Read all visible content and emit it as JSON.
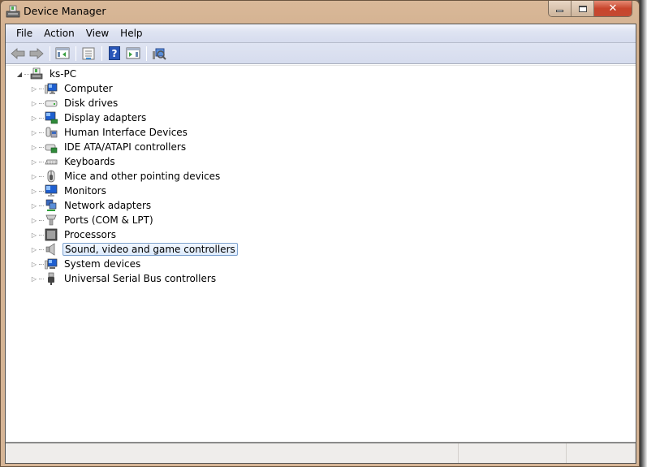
{
  "window": {
    "title": "Device Manager",
    "controls": {
      "minimize": "minimize",
      "maximize": "maximize",
      "close": "close"
    }
  },
  "menubar": {
    "items": [
      {
        "label": "File"
      },
      {
        "label": "Action"
      },
      {
        "label": "View"
      },
      {
        "label": "Help"
      }
    ]
  },
  "toolbar": {
    "buttons": [
      {
        "name": "back",
        "icon": "arrow-left-icon"
      },
      {
        "name": "forward",
        "icon": "arrow-right-icon"
      },
      {
        "name": "show-hide-console-tree",
        "icon": "console-tree-icon"
      },
      {
        "name": "properties",
        "icon": "properties-icon"
      },
      {
        "name": "help",
        "icon": "help-icon"
      },
      {
        "name": "show-action-pane",
        "icon": "action-pane-icon"
      },
      {
        "name": "scan-for-hardware-changes",
        "icon": "scan-hardware-icon"
      }
    ]
  },
  "tree": {
    "root": {
      "label": "ks-PC",
      "expanded": true,
      "icon": "computer-root-icon"
    },
    "children": [
      {
        "label": "Computer",
        "icon": "computer-icon"
      },
      {
        "label": "Disk drives",
        "icon": "disk-drive-icon"
      },
      {
        "label": "Display adapters",
        "icon": "display-adapter-icon"
      },
      {
        "label": "Human Interface Devices",
        "icon": "hid-icon"
      },
      {
        "label": "IDE ATA/ATAPI controllers",
        "icon": "ide-controller-icon"
      },
      {
        "label": "Keyboards",
        "icon": "keyboard-icon"
      },
      {
        "label": "Mice and other pointing devices",
        "icon": "mouse-icon"
      },
      {
        "label": "Monitors",
        "icon": "monitor-icon"
      },
      {
        "label": "Network adapters",
        "icon": "network-adapter-icon"
      },
      {
        "label": "Ports (COM & LPT)",
        "icon": "port-icon"
      },
      {
        "label": "Processors",
        "icon": "processor-icon"
      },
      {
        "label": "Sound, video and game controllers",
        "icon": "sound-icon",
        "selected": true
      },
      {
        "label": "System devices",
        "icon": "system-devices-icon"
      },
      {
        "label": "Universal Serial Bus controllers",
        "icon": "usb-icon"
      }
    ]
  },
  "statusbar": {
    "panes": [
      "",
      "",
      ""
    ]
  },
  "colors": {
    "selection_border": "#7da2ce",
    "menubar_bg": "#dfe4f2",
    "close_button": "#c8452c"
  }
}
